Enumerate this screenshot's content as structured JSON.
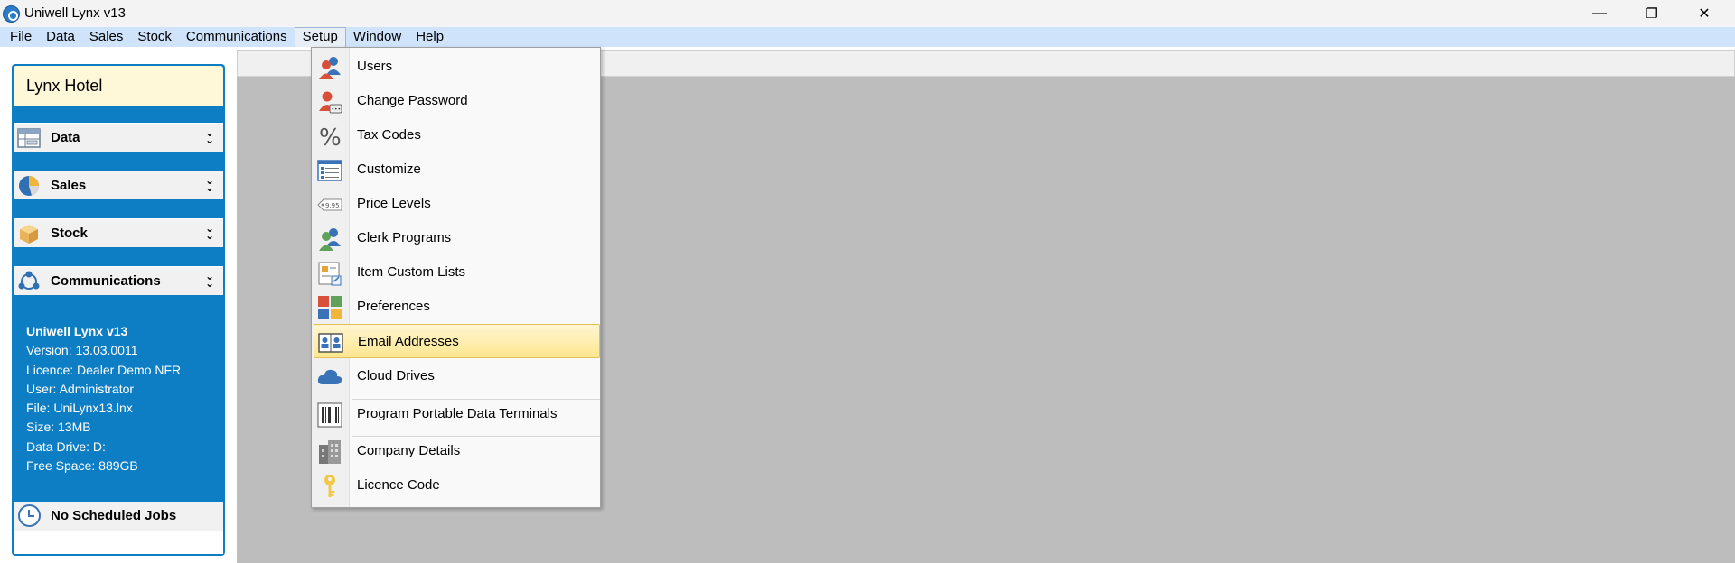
{
  "window": {
    "title": "Uniwell Lynx v13",
    "minimize": "—",
    "maximize": "❐",
    "close": "✕"
  },
  "menubar": {
    "items": [
      "File",
      "Data",
      "Sales",
      "Stock",
      "Communications",
      "Setup",
      "Window",
      "Help"
    ],
    "active": "Setup"
  },
  "sidebar": {
    "hotel": "Lynx Hotel",
    "sections": [
      {
        "label": "Data",
        "icon": "data-grid-icon"
      },
      {
        "label": "Sales",
        "icon": "pie-chart-icon"
      },
      {
        "label": "Stock",
        "icon": "box-icon"
      },
      {
        "label": "Communications",
        "icon": "network-icon"
      }
    ],
    "info": {
      "product": "Uniwell Lynx v13",
      "version": "Version: 13.03.0011",
      "licence": "Licence: Dealer Demo NFR",
      "user": "User: Administrator",
      "file": "File: UniLynx13.lnx",
      "size": "Size: 13MB",
      "data_drive": "Data Drive: D:",
      "free_space": "Free Space: 889GB"
    },
    "jobs": "No Scheduled Jobs"
  },
  "setup_menu": {
    "items": [
      {
        "label": "Users",
        "icon": "users-icon"
      },
      {
        "label": "Change Password",
        "icon": "user-password-icon"
      },
      {
        "label": "Tax Codes",
        "icon": "percent-icon"
      },
      {
        "label": "Customize",
        "icon": "list-form-icon"
      },
      {
        "label": "Price Levels",
        "icon": "price-tag-icon"
      },
      {
        "label": "Clerk Programs",
        "icon": "clerks-icon"
      },
      {
        "label": "Item Custom Lists",
        "icon": "custom-list-icon"
      },
      {
        "label": "Preferences",
        "icon": "preferences-tiles-icon"
      },
      {
        "label": "Email Addresses",
        "icon": "address-book-icon"
      },
      {
        "label": "Cloud Drives",
        "icon": "cloud-icon"
      },
      {
        "label": "Program Portable Data Terminals",
        "icon": "barcode-icon"
      },
      {
        "label": "Company Details",
        "icon": "building-icon"
      },
      {
        "label": "Licence Code",
        "icon": "key-icon"
      }
    ],
    "highlighted": "Email Addresses",
    "price_tag_text": "9.95"
  },
  "colors": {
    "sidebar_blue": "#0e7ec4",
    "menubar_blue": "#cfe3fb",
    "highlight": "#fde68f",
    "workspace_grey": "#bdbdbd"
  }
}
